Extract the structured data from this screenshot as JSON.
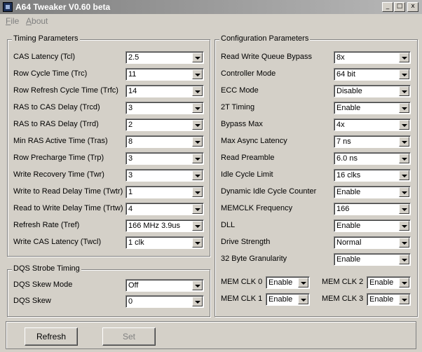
{
  "window": {
    "title": "A64 Tweaker V0.60 beta",
    "min_glyph": "_",
    "max_glyph": "□",
    "close_glyph": "x"
  },
  "menu": [
    {
      "label": "File",
      "accel": "F",
      "rest": "ile"
    },
    {
      "label": "About",
      "accel": "A",
      "rest": "bout"
    }
  ],
  "timing": {
    "title": "Timing Parameters",
    "rows": [
      {
        "label": "CAS Latency (Tcl)",
        "value": "2.5"
      },
      {
        "label": "Row Cycle Time (Trc)",
        "value": "11"
      },
      {
        "label": "Row Refresh Cycle Time (Trfc)",
        "value": "14"
      },
      {
        "label": "RAS to CAS Delay (Trcd)",
        "value": "3"
      },
      {
        "label": "RAS to RAS Delay (Trrd)",
        "value": "2"
      },
      {
        "label": "Min RAS Active Time (Tras)",
        "value": "8"
      },
      {
        "label": "Row Precharge Time (Trp)",
        "value": "3"
      },
      {
        "label": "Write Recovery Time (Twr)",
        "value": "3"
      },
      {
        "label": "Write to Read Delay Time (Twtr)",
        "value": "1"
      },
      {
        "label": "Read to Write Delay Time (Trtw)",
        "value": "4"
      },
      {
        "label": "Refresh Rate (Tref)",
        "value": "166 MHz 3.9us"
      },
      {
        "label": "Write CAS Latency (Twcl)",
        "value": "1 clk"
      }
    ]
  },
  "dqs": {
    "title": "DQS Strobe Timing",
    "rows": [
      {
        "label": "DQS Skew Mode",
        "value": "Off"
      },
      {
        "label": "DQS Skew",
        "value": "0"
      }
    ]
  },
  "config": {
    "title": "Configuration Parameters",
    "rows": [
      {
        "label": "Read Write Queue Bypass",
        "value": "8x"
      },
      {
        "label": "Controller Mode",
        "value": "64 bit"
      },
      {
        "label": "ECC Mode",
        "value": "Disable"
      },
      {
        "label": "2T Timing",
        "value": "Enable"
      },
      {
        "label": "Bypass Max",
        "value": "4x"
      },
      {
        "label": "Max Async Latency",
        "value": "7 ns"
      },
      {
        "label": "Read Preamble",
        "value": "6.0 ns"
      },
      {
        "label": "Idle Cycle Limit",
        "value": "16 clks"
      },
      {
        "label": "Dynamic Idle Cycle Counter",
        "value": "Enable"
      },
      {
        "label": "MEMCLK Frequency",
        "value": "166"
      },
      {
        "label": "DLL",
        "value": "Enable"
      },
      {
        "label": "Drive Strength",
        "value": "Normal"
      },
      {
        "label": "32 Byte Granularity",
        "value": "Enable"
      }
    ],
    "memclk": [
      {
        "label": "MEM CLK 0",
        "value": "Enable"
      },
      {
        "label": "MEM CLK 2",
        "value": "Enable"
      },
      {
        "label": "MEM CLK 1",
        "value": "Enable"
      },
      {
        "label": "MEM CLK 3",
        "value": "Enable"
      }
    ]
  },
  "buttons": {
    "refresh": "Refresh",
    "set": "Set"
  }
}
